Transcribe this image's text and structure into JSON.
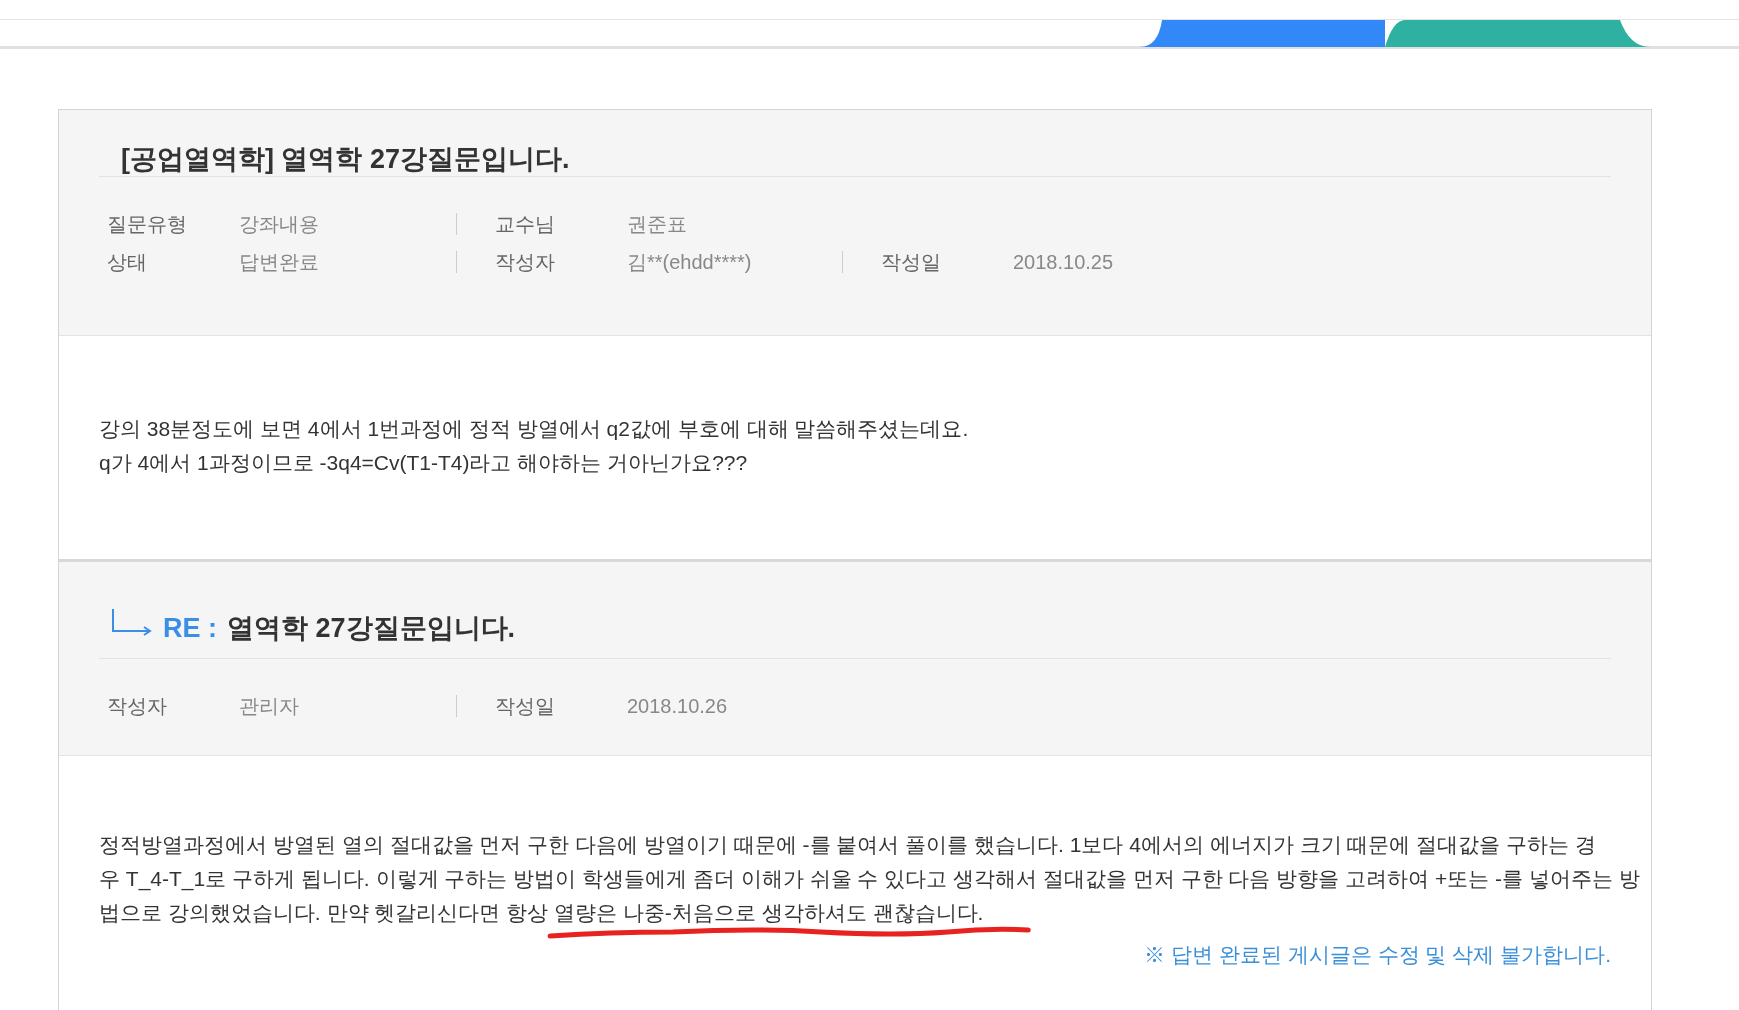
{
  "question": {
    "title": "[공업열역학] 열역학 27강질문입니다.",
    "meta_rows": [
      [
        {
          "label": "질문유형",
          "value": "강좌내용"
        },
        {
          "label": "교수님",
          "value": "권준표"
        }
      ],
      [
        {
          "label": "상태",
          "value": "답변완료"
        },
        {
          "label": "작성자",
          "value": "김**(ehdd****)"
        },
        {
          "label": "작성일",
          "value": "2018.10.25"
        }
      ]
    ],
    "body_lines": [
      "강의 38분정도에 보면 4에서 1번과정에 정적 방열에서 q2값에 부호에 대해 말씀해주셨는데요.",
      "q가 4에서 1과정이므로 -3q4=Cv(T1-T4)라고 해야하는 거아닌가요???"
    ]
  },
  "answer": {
    "prefix": "RE :",
    "title": "열역학 27강질문입니다.",
    "meta_rows": [
      [
        {
          "label": "작성자",
          "value": "관리자"
        },
        {
          "label": "작성일",
          "value": "2018.10.26"
        }
      ]
    ],
    "body_lines": [
      "정적방열과정에서 방열된 열의 절대값을 먼저 구한 다음에 방열이기 때문에 -를 붙여서 풀이를 했습니다. 1보다 4에서의 에너지가 크기 때문에 절대값을 구하는 경",
      "우 T_4-T_1로 구하게 됩니다. 이렇게 구하는 방법이 학생들에게 좀더 이해가 쉬울 수 있다고 생각해서 절대값을 먼저 구한 다음 방향을 고려하여 +또는 -를 넣어주는 방",
      "법으로 강의했었습니다. 만약 헷갈리신다면 항상 열량은 나중-처음으로 생각하셔도 괜찮습니다."
    ],
    "notice": "※ 답변 완료된 게시글은 수정 및 삭제 불가합니다."
  }
}
